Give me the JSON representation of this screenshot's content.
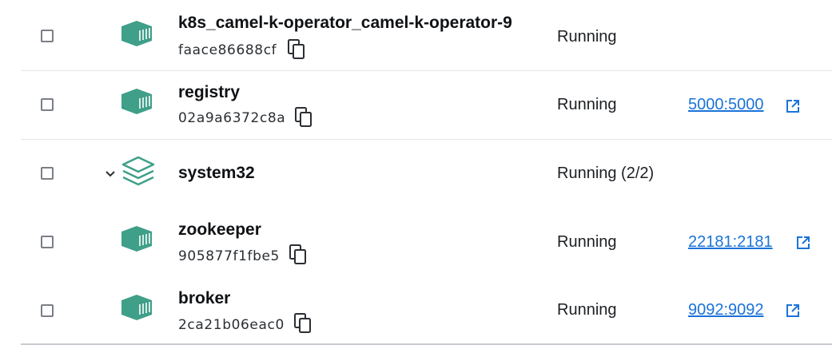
{
  "colors": {
    "accent": "#3f9f89",
    "link": "#1a73d9",
    "divider": "#e2e4e7"
  },
  "rows": [
    {
      "type": "container",
      "icon": "container-icon",
      "name": "k8s_camel-k-operator_camel-k-operator-9",
      "id": "faace86688cf",
      "status": "Running",
      "port": ""
    },
    {
      "type": "container",
      "icon": "container-icon",
      "name": "registry",
      "id": "02a9a6372c8a",
      "status": "Running",
      "port": "5000:5000"
    },
    {
      "type": "stack",
      "icon": "stack-icon",
      "name": "system32",
      "id": "",
      "status": "Running (2/2)",
      "port": ""
    },
    {
      "type": "container",
      "icon": "container-icon",
      "name": "zookeeper",
      "id": "905877f1fbe5",
      "status": "Running",
      "port": "22181:2181"
    },
    {
      "type": "container",
      "icon": "container-icon",
      "name": "broker",
      "id": "2ca21b06eac0",
      "status": "Running",
      "port": "9092:9092"
    }
  ]
}
